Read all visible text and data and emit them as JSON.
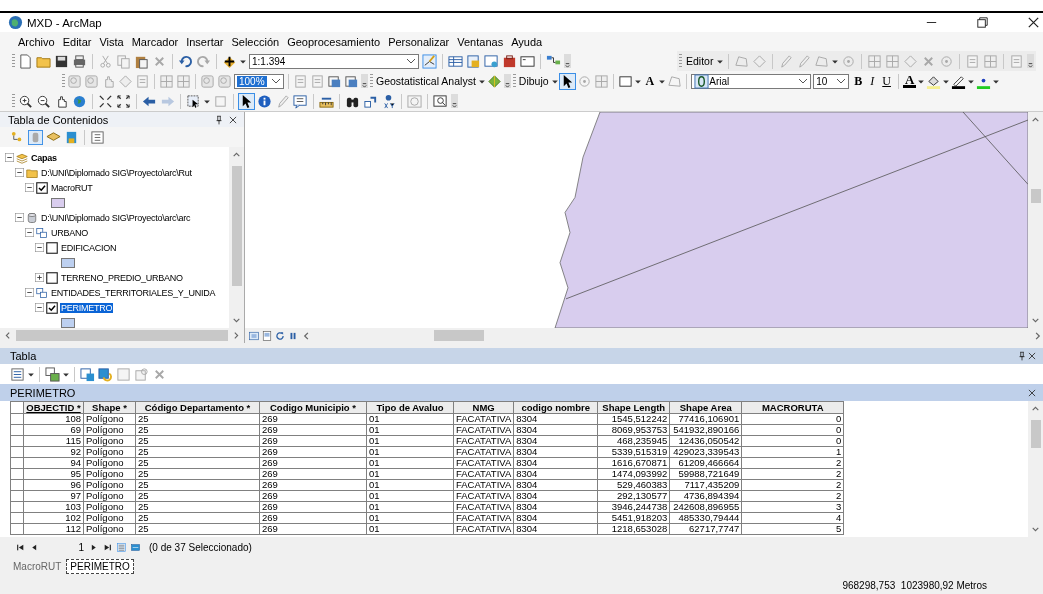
{
  "window": {
    "title": "MXD - ArcMap"
  },
  "menu": [
    "Archivo",
    "Editar",
    "Vista",
    "Marcador",
    "Insertar",
    "Selección",
    "Geoprocesamiento",
    "Personalizar",
    "Ventanas",
    "Ayuda"
  ],
  "toolbars": {
    "scale": "1:1.394",
    "zoom_percent": "100%",
    "geostatistical": "Geostatistical Analyst",
    "editor": "Editor",
    "drawing": "Dibujo",
    "text_tool": "A",
    "font": "Arial",
    "font_size": "10",
    "format_buttons": [
      "B",
      "I",
      "U"
    ],
    "font_color": "A",
    "pointer_active": true
  },
  "toc": {
    "title": "Tabla de Contenidos",
    "tree": [
      {
        "label": "Capas",
        "kind": "root",
        "expanded": true,
        "selected": false,
        "children": [
          {
            "label": "D:\\UNI\\Diplomado SIG\\Proyecto\\arc\\Rut",
            "kind": "folder",
            "expanded": true,
            "selected": false,
            "children": [
              {
                "label": "MacroRUT",
                "kind": "layer",
                "expanded": true,
                "checked": true,
                "selected": false,
                "color": "#d9cdee"
              }
            ]
          },
          {
            "label": "D:\\UNI\\Diplomado SIG\\Proyecto\\arc\\arc",
            "kind": "database",
            "expanded": true,
            "selected": false,
            "children": [
              {
                "label": "URBANO",
                "kind": "group",
                "expanded": true,
                "selected": false,
                "children": [
                  {
                    "label": "EDIFICACION",
                    "kind": "layer",
                    "expanded": true,
                    "checked": false,
                    "selected": false,
                    "color": "#bdd0f0"
                  },
                  {
                    "label": "TERRENO_PREDIO_URBANO",
                    "kind": "layer",
                    "expanded": false,
                    "checked": false,
                    "selected": false
                  }
                ]
              },
              {
                "label": "ENTIDADES_TERRITORIALES_Y_UNIDA",
                "kind": "group",
                "expanded": true,
                "selected": false,
                "children": [
                  {
                    "label": "PERIMETRO",
                    "kind": "layer",
                    "expanded": true,
                    "checked": true,
                    "selected": true,
                    "color": "#bdd0f0"
                  }
                ]
              }
            ]
          }
        ]
      }
    ]
  },
  "table": {
    "panel_title": "Tabla",
    "name": "PERIMETRO",
    "columns": [
      {
        "label": "OBJECTID *",
        "kind": "number",
        "sorted": true
      },
      {
        "label": "Shape *",
        "kind": "text",
        "sorted": false
      },
      {
        "label": "Código Departamento *",
        "kind": "text",
        "sorted": false
      },
      {
        "label": "Codigo Municipio *",
        "kind": "text",
        "sorted": false
      },
      {
        "label": "Tipo de Avaluo",
        "kind": "text",
        "sorted": false
      },
      {
        "label": "NMG",
        "kind": "text",
        "sorted": false
      },
      {
        "label": "codigo nombre",
        "kind": "text",
        "sorted": false
      },
      {
        "label": "Shape Length",
        "kind": "number",
        "sorted": false
      },
      {
        "label": "Shape Area",
        "kind": "number",
        "sorted": false
      },
      {
        "label": "MACRORUTA",
        "kind": "number",
        "sorted": false
      }
    ],
    "rows": [
      [
        "108",
        "Polígono",
        "25",
        "269",
        "01",
        "FACATATIVA",
        "8304",
        "1545,512242",
        "77416,106901",
        "0"
      ],
      [
        "69",
        "Polígono",
        "25",
        "269",
        "01",
        "FACATATIVA",
        "8304",
        "8069,953753",
        "541932,890166",
        "0"
      ],
      [
        "115",
        "Polígono",
        "25",
        "269",
        "01",
        "FACATATIVA",
        "8304",
        "468,235945",
        "12436,050542",
        "0"
      ],
      [
        "92",
        "Polígono",
        "25",
        "269",
        "01",
        "FACATATIVA",
        "8304",
        "5339,515319",
        "429023,339543",
        "1"
      ],
      [
        "94",
        "Polígono",
        "25",
        "269",
        "01",
        "FACATATIVA",
        "8304",
        "1616,670871",
        "61209,466664",
        "2"
      ],
      [
        "95",
        "Polígono",
        "25",
        "269",
        "01",
        "FACATATIVA",
        "8304",
        "1474,093992",
        "59988,721649",
        "2"
      ],
      [
        "96",
        "Polígono",
        "25",
        "269",
        "01",
        "FACATATIVA",
        "8304",
        "529,460383",
        "7117,435209",
        "2"
      ],
      [
        "97",
        "Polígono",
        "25",
        "269",
        "01",
        "FACATATIVA",
        "8304",
        "292,130577",
        "4736,894394",
        "2"
      ],
      [
        "103",
        "Polígono",
        "25",
        "269",
        "01",
        "FACATATIVA",
        "8304",
        "3946,244738",
        "242608,896955",
        "3"
      ],
      [
        "102",
        "Polígono",
        "25",
        "269",
        "01",
        "FACATATIVA",
        "8304",
        "5451,918203",
        "485330,79444",
        "4"
      ],
      [
        "112",
        "Polígono",
        "25",
        "269",
        "01",
        "FACATATIVA",
        "8304",
        "1218,653028",
        "62717,7747",
        "5"
      ]
    ],
    "record": "1",
    "selection": "(0 de 37 Seleccionado)",
    "tabs": [
      {
        "label": "MacroRUT",
        "selected": false
      },
      {
        "label": "PERIMETRO",
        "selected": true
      }
    ]
  },
  "status_bar": {
    "coordinates": "968298,753  1023980,92 Metros"
  }
}
